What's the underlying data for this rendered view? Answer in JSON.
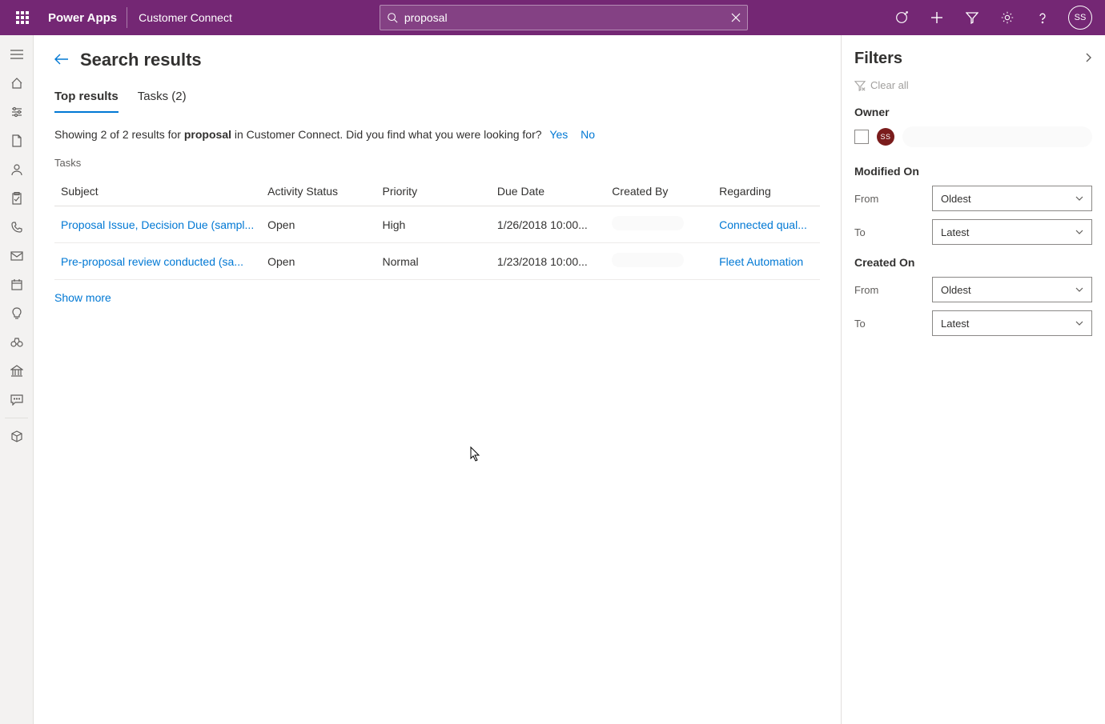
{
  "header": {
    "brand": "Power Apps",
    "app_name": "Customer Connect",
    "search_value": "proposal",
    "avatar_initials": "SS"
  },
  "page": {
    "title": "Search results",
    "tabs": [
      {
        "label": "Top results",
        "active": true
      },
      {
        "label": "Tasks (2)",
        "active": false
      }
    ],
    "summary_prefix": "Showing 2 of 2 results for ",
    "summary_term": "proposal",
    "summary_suffix": " in Customer Connect. Did you find what you were looking for?",
    "summary_yes": "Yes",
    "summary_no": "No",
    "section_label": "Tasks",
    "show_more": "Show more"
  },
  "columns": {
    "subject": "Subject",
    "activity_status": "Activity Status",
    "priority": "Priority",
    "due_date": "Due Date",
    "created_by": "Created By",
    "regarding": "Regarding"
  },
  "rows": [
    {
      "subject": "Proposal Issue, Decision Due (sampl...",
      "activity_status": "Open",
      "priority": "High",
      "due_date": "1/26/2018 10:00...",
      "regarding": "Connected qual..."
    },
    {
      "subject": "Pre-proposal review conducted (sa...",
      "activity_status": "Open",
      "priority": "Normal",
      "due_date": "1/23/2018 10:00...",
      "regarding": "Fleet Automation"
    }
  ],
  "filters": {
    "title": "Filters",
    "clear_all": "Clear all",
    "owner_label": "Owner",
    "owner_initials": "SS",
    "modified_on_label": "Modified On",
    "created_on_label": "Created On",
    "from_label": "From",
    "to_label": "To",
    "oldest": "Oldest",
    "latest": "Latest"
  }
}
